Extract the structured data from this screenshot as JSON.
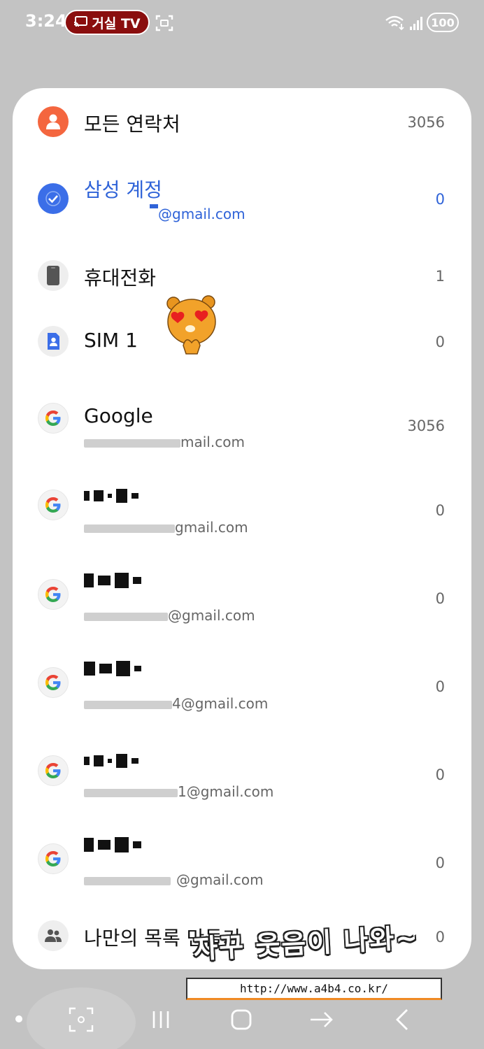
{
  "status_bar": {
    "time": "3:24",
    "cast_label": "거실 TV",
    "battery": "100",
    "icons": [
      "cast-icon",
      "screen-record-icon",
      "wifi-icon",
      "signal-icon",
      "battery-icon"
    ]
  },
  "accounts": [
    {
      "title": "모든 연락처",
      "count": "3056",
      "icon": "person-icon",
      "color": "#f4663f"
    },
    {
      "title": "삼성 계정",
      "subtitle": "@gmail.com",
      "count": "0",
      "icon": "check-icon",
      "color": "#3b6ee8",
      "selected": true
    },
    {
      "title": "휴대전화",
      "count": "1",
      "icon": "phone-icon"
    },
    {
      "title": "SIM 1",
      "count": "0",
      "icon": "sim-contact-icon",
      "color": "#3b6ee8"
    },
    {
      "title": "Google",
      "subtitle": "mail.com",
      "count": "3056",
      "icon": "google-icon"
    },
    {
      "subtitle": "gmail.com",
      "count": "0",
      "icon": "google-icon"
    },
    {
      "subtitle": "@gmail.com",
      "count": "0",
      "icon": "google-icon"
    },
    {
      "subtitle": "4@gmail.com",
      "count": "0",
      "icon": "google-icon"
    },
    {
      "subtitle": "1@gmail.com",
      "count": "0",
      "icon": "google-icon"
    },
    {
      "subtitle": "@gmail.com",
      "count": "0",
      "icon": "google-icon"
    },
    {
      "title": "나만의 목록 만들기",
      "count": "0",
      "icon": "group-icon"
    }
  ],
  "watermark": {
    "caption": "자꾸 웃음이 나와~",
    "url": "http://www.a4b4.co.kr/"
  },
  "nav_bar": {
    "icons": [
      "capture-icon",
      "recents-icon",
      "home-icon",
      "forward-arrow-icon",
      "back-icon"
    ]
  },
  "colors": {
    "accent_blue": "#2f63d8",
    "background": "#c3c3c3",
    "card": "#ffffff"
  }
}
